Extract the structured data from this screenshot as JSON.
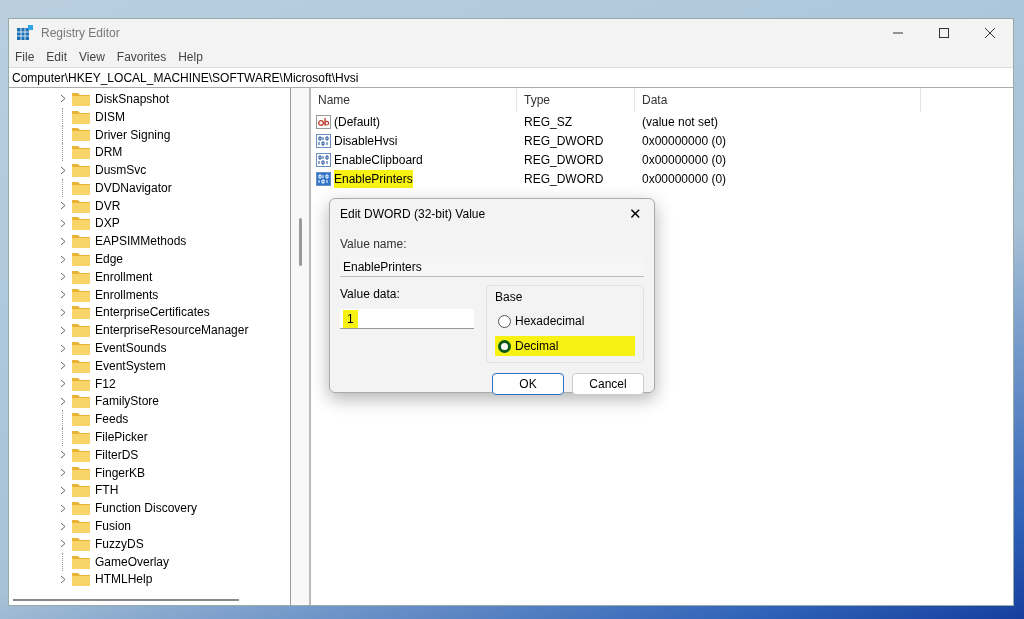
{
  "window": {
    "title": "Registry Editor"
  },
  "menu": [
    "File",
    "Edit",
    "View",
    "Favorites",
    "Help"
  ],
  "address": "Computer\\HKEY_LOCAL_MACHINE\\SOFTWARE\\Microsoft\\Hvsi",
  "tree": [
    {
      "label": "DiskSnapshot",
      "expandable": true
    },
    {
      "label": "DISM",
      "expandable": false
    },
    {
      "label": "Driver Signing",
      "expandable": false
    },
    {
      "label": "DRM",
      "expandable": false
    },
    {
      "label": "DusmSvc",
      "expandable": true
    },
    {
      "label": "DVDNavigator",
      "expandable": false
    },
    {
      "label": "DVR",
      "expandable": true
    },
    {
      "label": "DXP",
      "expandable": true
    },
    {
      "label": "EAPSIMMethods",
      "expandable": true
    },
    {
      "label": "Edge",
      "expandable": true
    },
    {
      "label": "Enrollment",
      "expandable": true
    },
    {
      "label": "Enrollments",
      "expandable": true
    },
    {
      "label": "EnterpriseCertificates",
      "expandable": true
    },
    {
      "label": "EnterpriseResourceManager",
      "expandable": true
    },
    {
      "label": "EventSounds",
      "expandable": true
    },
    {
      "label": "EventSystem",
      "expandable": true
    },
    {
      "label": "F12",
      "expandable": true
    },
    {
      "label": "FamilyStore",
      "expandable": true
    },
    {
      "label": "Feeds",
      "expandable": false
    },
    {
      "label": "FilePicker",
      "expandable": false
    },
    {
      "label": "FilterDS",
      "expandable": true
    },
    {
      "label": "FingerKB",
      "expandable": true
    },
    {
      "label": "FTH",
      "expandable": true
    },
    {
      "label": "Function Discovery",
      "expandable": true
    },
    {
      "label": "Fusion",
      "expandable": true
    },
    {
      "label": "FuzzyDS",
      "expandable": true
    },
    {
      "label": "GameOverlay",
      "expandable": false
    },
    {
      "label": "HTMLHelp",
      "expandable": true
    }
  ],
  "values": {
    "columns": [
      "Name",
      "Type",
      "Data"
    ],
    "rows": [
      {
        "kind": "string",
        "name": "(Default)",
        "type": "REG_SZ",
        "data": "(value not set)",
        "selected": false,
        "highlighted": false
      },
      {
        "kind": "dword",
        "name": "DisableHvsi",
        "type": "REG_DWORD",
        "data": "0x00000000 (0)",
        "selected": false,
        "highlighted": false
      },
      {
        "kind": "dword",
        "name": "EnableClipboard",
        "type": "REG_DWORD",
        "data": "0x00000000 (0)",
        "selected": false,
        "highlighted": false
      },
      {
        "kind": "dword",
        "name": "EnablePrinters",
        "type": "REG_DWORD",
        "data": "0x00000000 (0)",
        "selected": true,
        "highlighted": true
      }
    ]
  },
  "dialog": {
    "title": "Edit DWORD (32-bit) Value",
    "close": "✕",
    "value_name_label": "Value name:",
    "value_name": "EnablePrinters",
    "value_data_label": "Value data:",
    "value_data": "1",
    "value_data_highlighted": true,
    "base_label": "Base",
    "base_options": [
      {
        "label": "Hexadecimal",
        "selected": false,
        "highlighted": false
      },
      {
        "label": "Decimal",
        "selected": true,
        "highlighted": true
      }
    ],
    "buttons": [
      {
        "label": "OK",
        "default": true
      },
      {
        "label": "Cancel",
        "default": false
      }
    ]
  }
}
